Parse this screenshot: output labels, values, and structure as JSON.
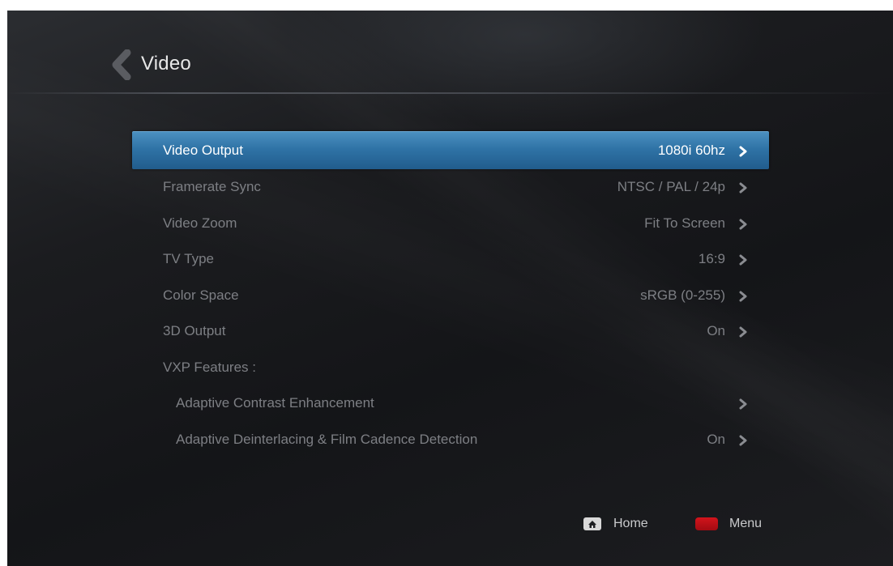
{
  "header": {
    "title": "Video",
    "back_icon": "chevron-left-icon"
  },
  "menu": {
    "items": [
      {
        "label": "Video Output",
        "value": "1080i 60hz",
        "selected": true,
        "sub": false,
        "chevron": true
      },
      {
        "label": "Framerate Sync",
        "value": "NTSC / PAL / 24p",
        "selected": false,
        "sub": false,
        "chevron": true
      },
      {
        "label": "Video Zoom",
        "value": "Fit To Screen",
        "selected": false,
        "sub": false,
        "chevron": true
      },
      {
        "label": "TV Type",
        "value": "16:9",
        "selected": false,
        "sub": false,
        "chevron": true
      },
      {
        "label": "Color Space",
        "value": "sRGB (0-255)",
        "selected": false,
        "sub": false,
        "chevron": true
      },
      {
        "label": "3D Output",
        "value": "On",
        "selected": false,
        "sub": false,
        "chevron": true
      },
      {
        "label": "VXP Features :",
        "value": "",
        "selected": false,
        "sub": false,
        "chevron": false
      },
      {
        "label": "Adaptive Contrast Enhancement",
        "value": "",
        "selected": false,
        "sub": true,
        "chevron": true
      },
      {
        "label": "Adaptive Deinterlacing & Film Cadence Detection",
        "value": "On",
        "selected": false,
        "sub": true,
        "chevron": true
      }
    ]
  },
  "footer": {
    "home_label": "Home",
    "home_icon": "home-icon",
    "menu_label": "Menu",
    "menu_icon": "red-button-icon",
    "menu_color": "#c0111a"
  },
  "colors": {
    "selected_row": "#2f73a6",
    "background": "#18191c"
  }
}
